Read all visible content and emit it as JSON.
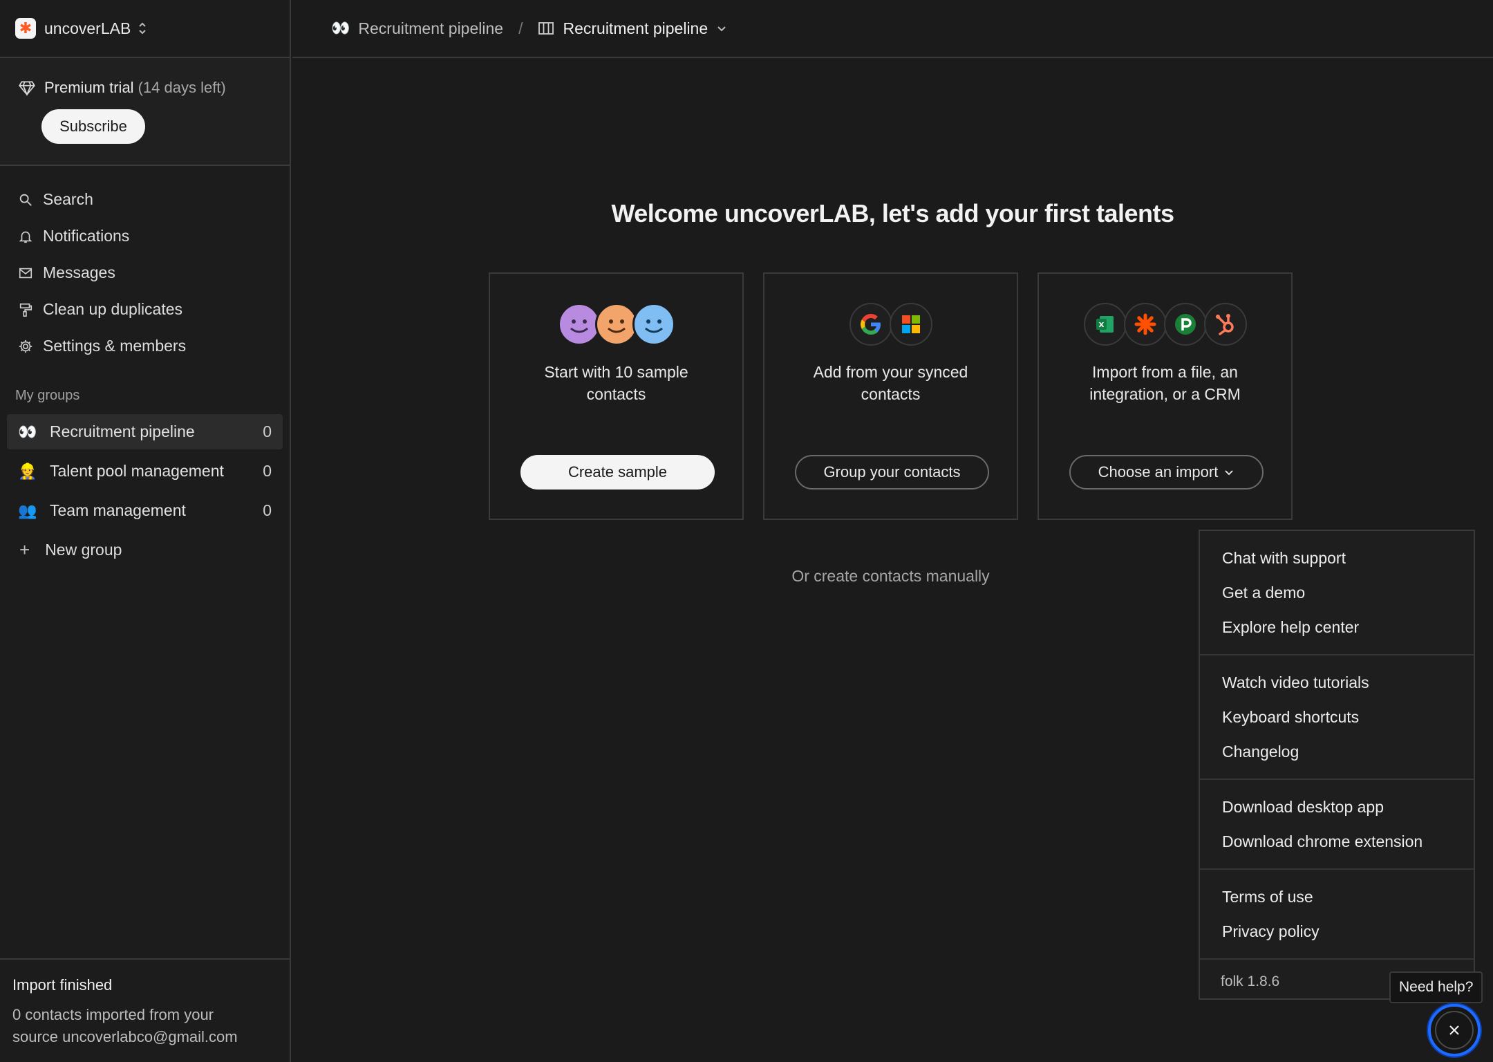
{
  "workspace": {
    "name": "uncoverLAB",
    "logo_glyph": "✱"
  },
  "trial": {
    "label": "Premium trial",
    "days_left": "(14 days left)",
    "subscribe_label": "Subscribe"
  },
  "nav": {
    "search": "Search",
    "notifications": "Notifications",
    "messages": "Messages",
    "cleanup": "Clean up duplicates",
    "settings": "Settings & members"
  },
  "groups": {
    "label": "My groups",
    "items": [
      {
        "icon": "👀",
        "label": "Recruitment pipeline",
        "count": "0"
      },
      {
        "icon": "👷",
        "label": "Talent pool management",
        "count": "0"
      },
      {
        "icon": "👥",
        "label": "Team management",
        "count": "0"
      }
    ],
    "new_group": "New group"
  },
  "import_status": {
    "title": "Import finished",
    "desc_line1": "0 contacts imported from your",
    "desc_line2": "source uncoverlabco@gmail.com"
  },
  "topbar": {
    "crumb_icon": "👀",
    "crumb_label": "Recruitment pipeline",
    "separator": "/",
    "view_label": "Recruitment pipeline"
  },
  "main": {
    "welcome": "Welcome uncoverLAB, let's add your first talents",
    "cards": [
      {
        "line1": "Start with 10 sample",
        "line2": "contacts",
        "button": "Create sample"
      },
      {
        "line1": "Add from your synced",
        "line2": "contacts",
        "button": "Group your contacts"
      },
      {
        "line1": "Import from a file, an",
        "line2": "integration, or a CRM",
        "button": "Choose an import"
      }
    ],
    "manual_link": "Or create contacts manually"
  },
  "help_menu": {
    "section1": [
      "Chat with support",
      "Get a demo",
      "Explore help center"
    ],
    "section2": [
      "Watch video tutorials",
      "Keyboard shortcuts",
      "Changelog"
    ],
    "section3": [
      "Download desktop app",
      "Download chrome extension"
    ],
    "section4": [
      "Terms of use",
      "Privacy policy"
    ],
    "version": "folk 1.8.6"
  },
  "need_help": "Need help?",
  "colors": {
    "accent_ring": "#1e6bff",
    "brand_logo": "#ff5a1f"
  }
}
